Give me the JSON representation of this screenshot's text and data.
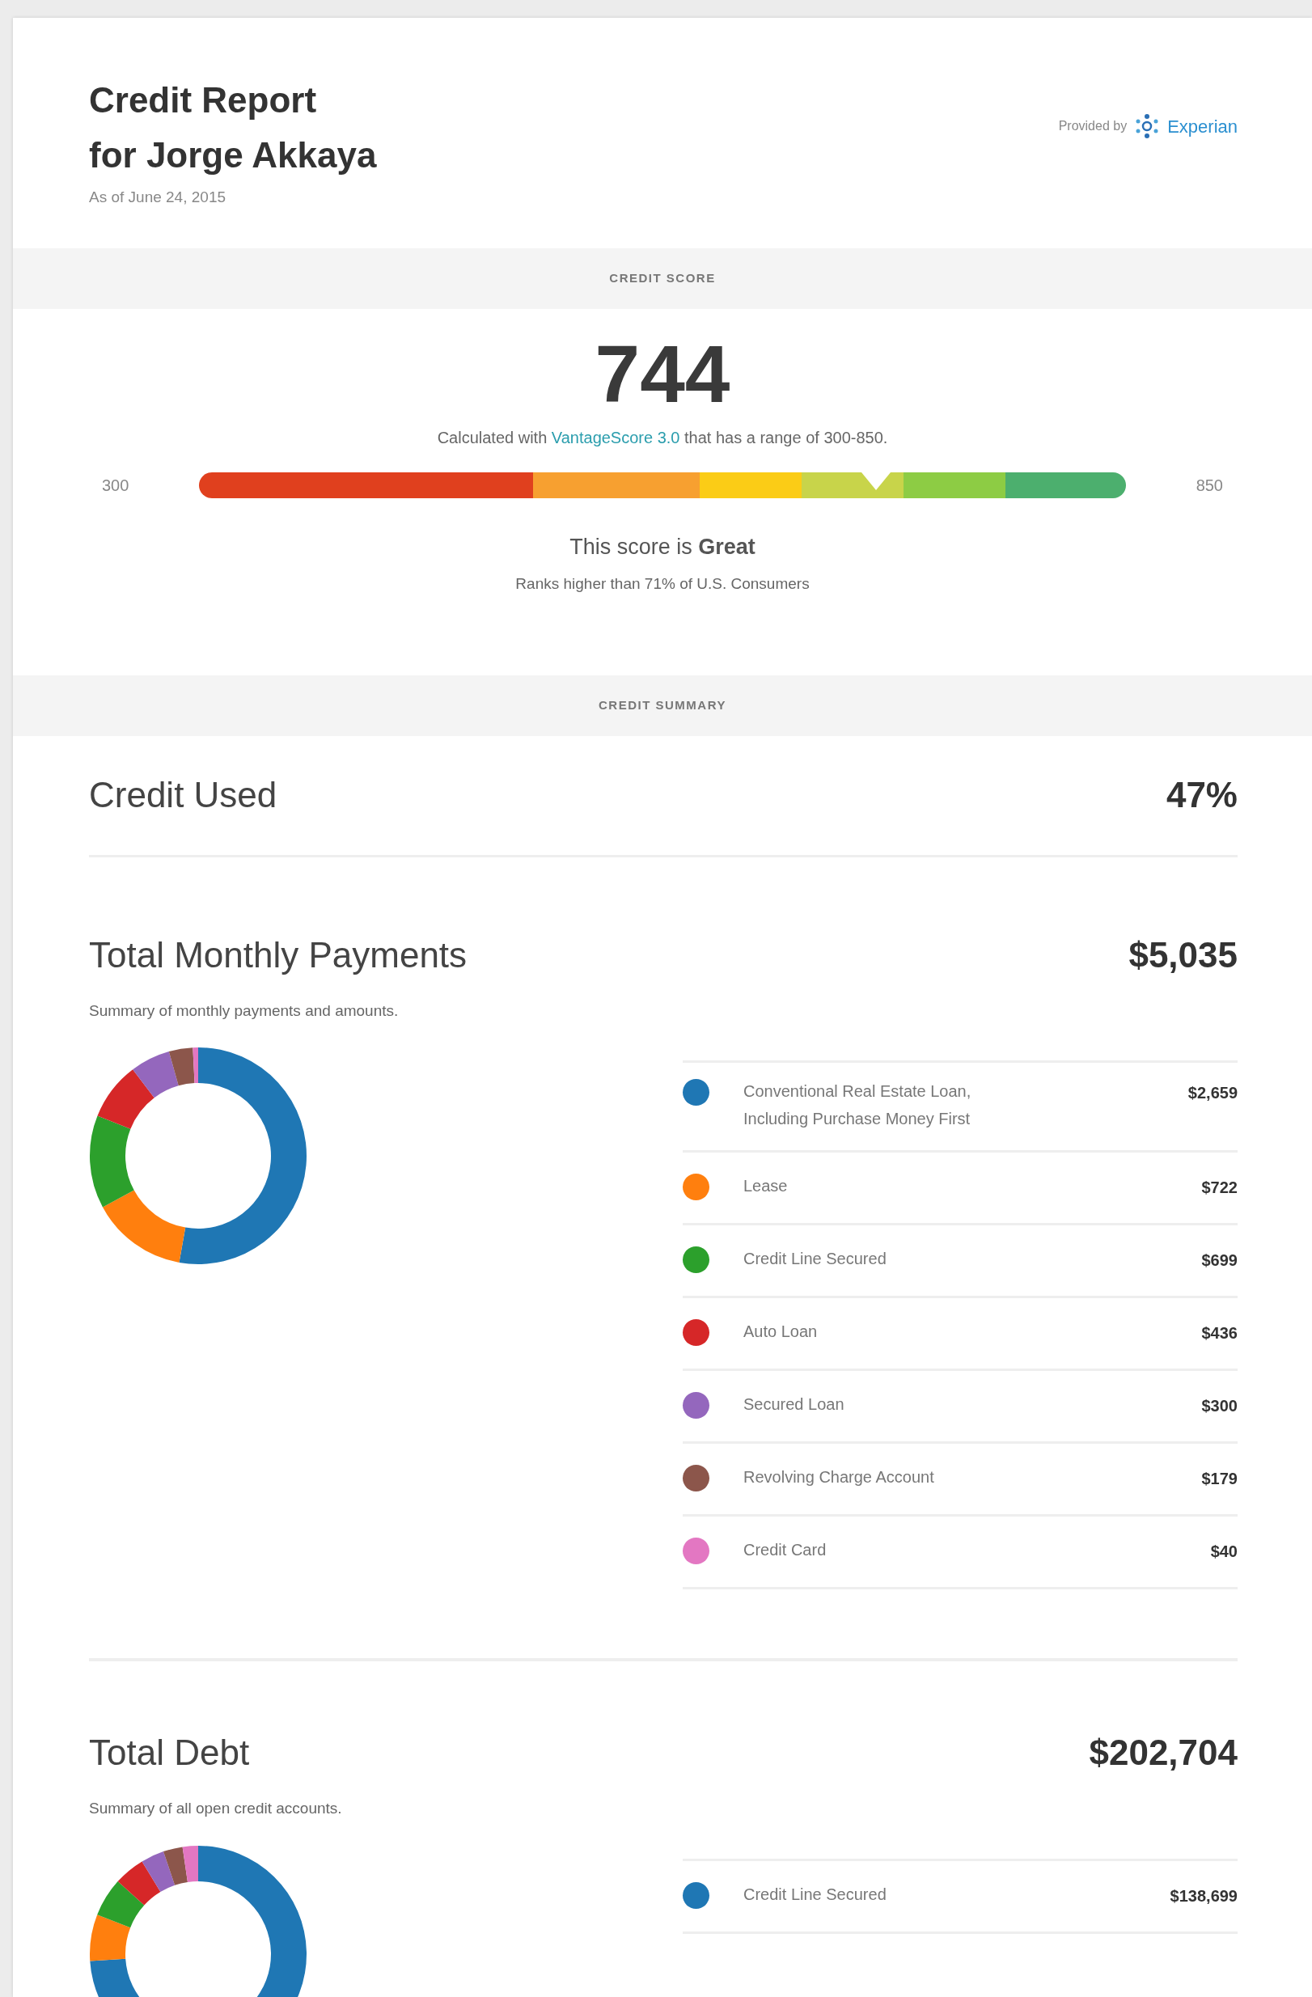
{
  "header": {
    "title_lines": [
      "Credit Report",
      "for Jorge Akkaya"
    ],
    "date": "As of June 24, 2015",
    "provider_label": "Provided by",
    "provider_logo_text": "Experian"
  },
  "credit_score": {
    "section_label": "CREDIT SCORE",
    "score": "744",
    "calc_parts": [
      "Calculated with",
      "VantageScore 3.0",
      "that has a range of 300-850."
    ],
    "min_label": "300",
    "max_label": "850",
    "level": 0.73,
    "rating_text": "This score is **Great**",
    "rank_text": "Ranks higher than 71% of U.S. Consumers"
  },
  "credit_summary": {
    "section_label": "CREDIT SUMMARY",
    "credit_used": {
      "title": "Credit Used",
      "value": "47%"
    },
    "monthly_payments": {
      "title": "Total Monthly Payments",
      "value": "$5,035",
      "subtitle": "Summary of monthly payments and amounts.",
      "chart_data": {
        "type": "donut",
        "values": [
          52.81,
          14.34,
          13.88,
          8.66,
          5.96,
          3.56,
          0.79
        ]
      },
      "items": [
        {
          "label": "Conventional Real Estate Loan, Including Purchase Money First",
          "amount": "$2,659",
          "color": "#1f77b4"
        },
        {
          "label": "Lease",
          "amount": "$722",
          "color": "#ff7f0e"
        },
        {
          "label": "Credit Line Secured",
          "amount": "$699",
          "color": "#2ca02c"
        },
        {
          "label": "Auto Loan",
          "amount": "$436",
          "color": "#d62728"
        },
        {
          "label": "Secured Loan",
          "amount": "$300",
          "color": "#9467bd"
        },
        {
          "label": "Revolving Charge Account",
          "amount": "$179",
          "color": "#8c564b"
        },
        {
          "label": "Credit Card",
          "amount": "$40",
          "color": "#e377c2"
        }
      ]
    },
    "total_debt": {
      "title": "Total Debt",
      "value": "$202,704",
      "subtitle": "Summary of all open credit accounts.",
      "items": [
        {
          "label": "Credit Line Secured",
          "amount": "$138,699",
          "color": "#1f77b4"
        }
      ]
    }
  }
}
